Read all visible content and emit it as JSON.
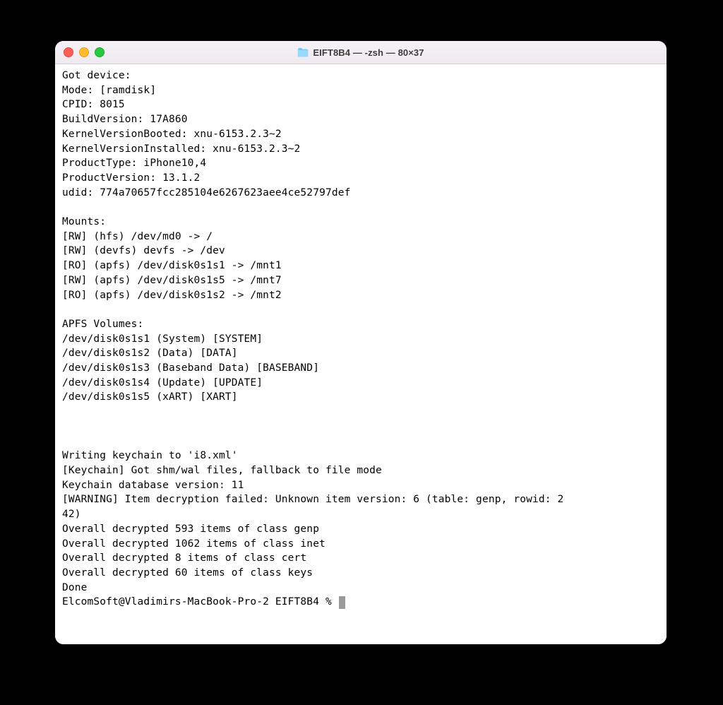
{
  "window": {
    "title": "EIFT8B4 — -zsh — 80×37"
  },
  "terminal": {
    "lines": [
      "Got device:",
      "Mode: [ramdisk]",
      "CPID: 8015",
      "BuildVersion: 17A860",
      "KernelVersionBooted: xnu-6153.2.3~2",
      "KernelVersionInstalled: xnu-6153.2.3~2",
      "ProductType: iPhone10,4",
      "ProductVersion: 13.1.2",
      "udid: 774a70657fcc285104e6267623aee4ce52797def",
      "",
      "Mounts:",
      "[RW] (hfs) /dev/md0 -> /",
      "[RW] (devfs) devfs -> /dev",
      "[RO] (apfs) /dev/disk0s1s1 -> /mnt1",
      "[RW] (apfs) /dev/disk0s1s5 -> /mnt7",
      "[RO] (apfs) /dev/disk0s1s2 -> /mnt2",
      "",
      "APFS Volumes:",
      "/dev/disk0s1s1 (System) [SYSTEM]",
      "/dev/disk0s1s2 (Data) [DATA]",
      "/dev/disk0s1s3 (Baseband Data) [BASEBAND]",
      "/dev/disk0s1s4 (Update) [UPDATE]",
      "/dev/disk0s1s5 (xART) [XART]",
      "",
      "",
      "",
      "Writing keychain to 'i8.xml'",
      "[Keychain] Got shm/wal files, fallback to file mode",
      "Keychain database version: 11",
      "[WARNING] Item decryption failed: Unknown item version: 6 (table: genp, rowid: 2",
      "42)",
      "Overall decrypted 593 items of class genp",
      "Overall decrypted 1062 items of class inet",
      "Overall decrypted 8 items of class cert",
      "Overall decrypted 60 items of class keys",
      "Done"
    ],
    "prompt": "ElcomSoft@Vladimirs-MacBook-Pro-2 EIFT8B4 % "
  }
}
